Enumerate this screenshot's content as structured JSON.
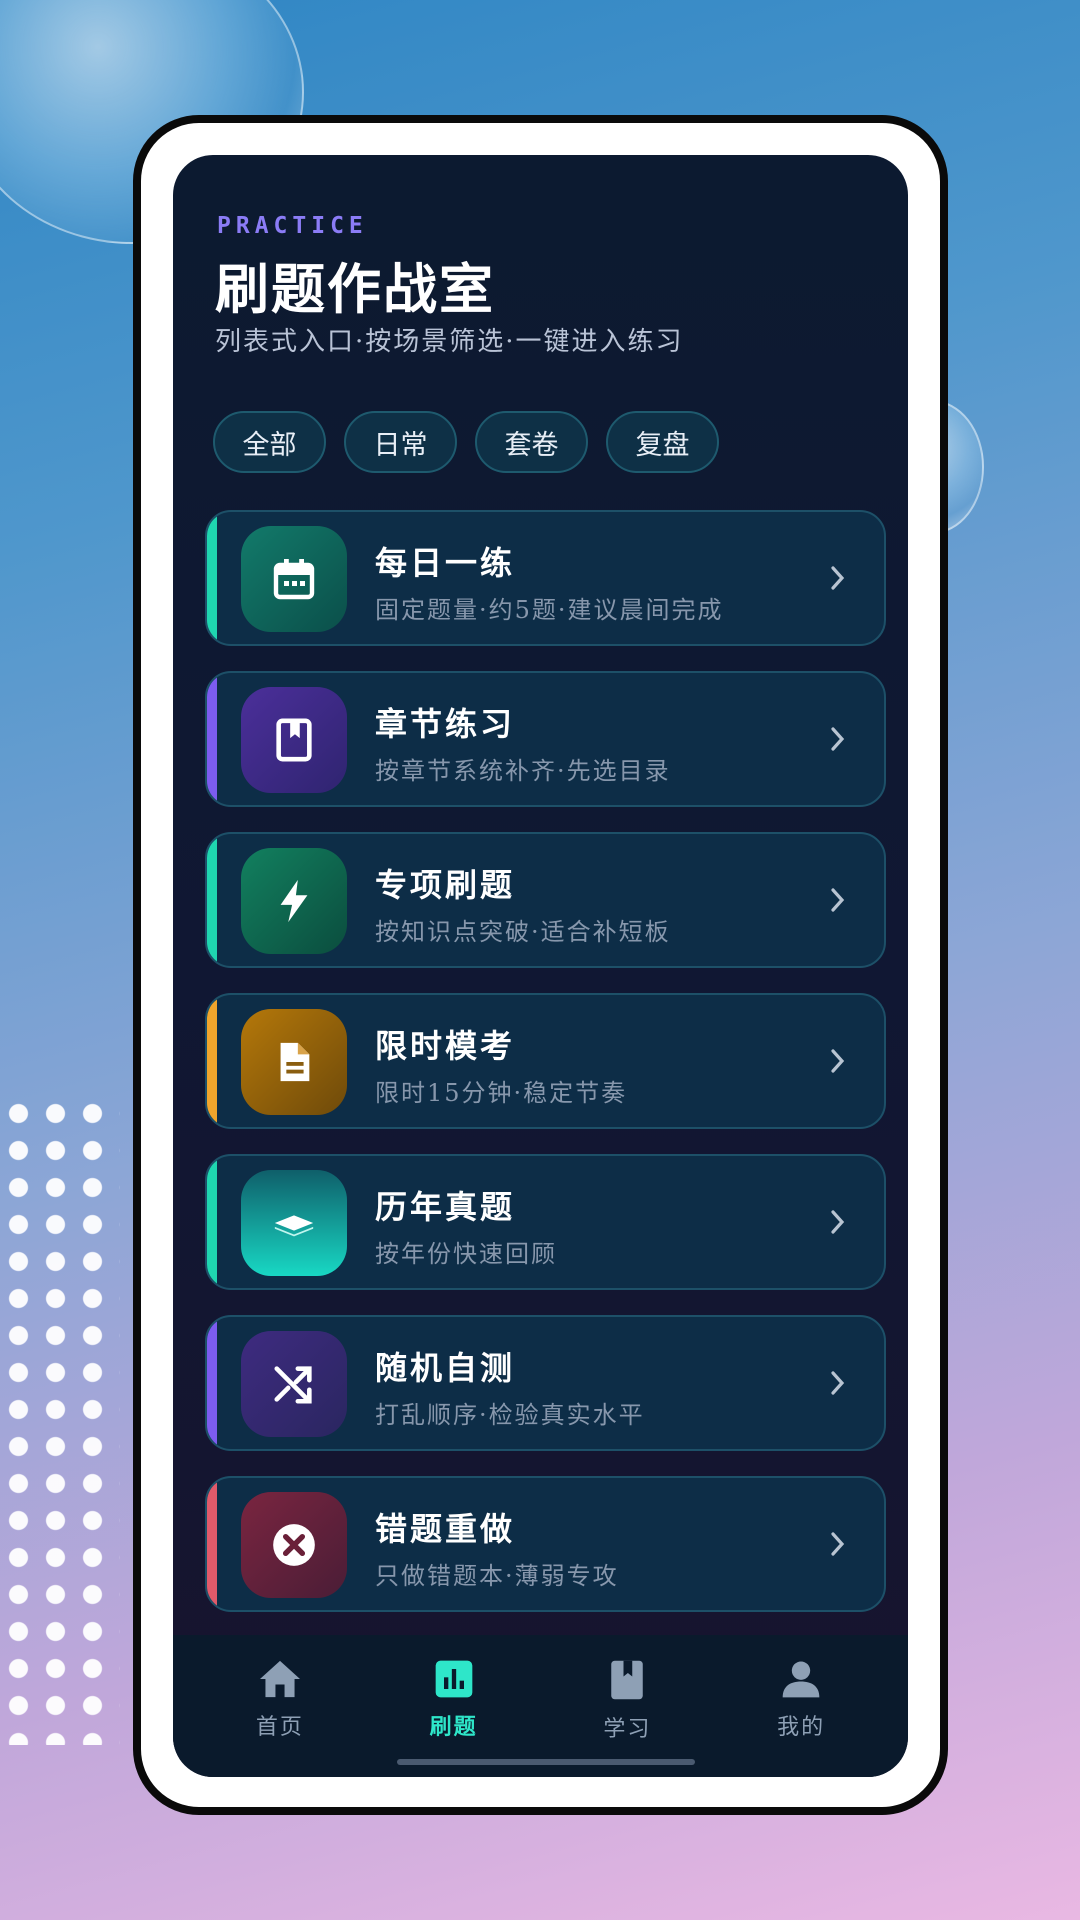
{
  "header": {
    "eyebrow": "PRACTICE",
    "title": "刷题作战室",
    "subtitle": "列表式入口·按场景筛选·一键进入练习"
  },
  "filters": [
    {
      "label": "全部"
    },
    {
      "label": "日常"
    },
    {
      "label": "套卷"
    },
    {
      "label": "复盘"
    }
  ],
  "items": [
    {
      "title": "每日一练",
      "desc": "固定题量·约5题·建议晨间完成",
      "icon": "calendar-icon",
      "accent": "#1fd6b0"
    },
    {
      "title": "章节练习",
      "desc": "按章节系统补齐·先选目录",
      "icon": "book-icon",
      "accent": "#7c5cf0"
    },
    {
      "title": "专项刷题",
      "desc": "按知识点突破·适合补短板",
      "icon": "lightning-icon",
      "accent": "#1fd6b0"
    },
    {
      "title": "限时模考",
      "desc": "限时15分钟·稳定节奏",
      "icon": "document-icon",
      "accent": "#f0a52c"
    },
    {
      "title": "历年真题",
      "desc": "按年份快速回顾",
      "icon": "layers-icon",
      "accent": "#1fd6b0"
    },
    {
      "title": "随机自测",
      "desc": "打乱顺序·检验真实水平",
      "icon": "shuffle-icon",
      "accent": "#7c5cf0"
    },
    {
      "title": "错题重做",
      "desc": "只做错题本·薄弱专攻",
      "icon": "close-circle-icon",
      "accent": "#e05a6a"
    }
  ],
  "tabs": [
    {
      "label": "首页",
      "icon": "home-icon",
      "active": false
    },
    {
      "label": "刷题",
      "icon": "chart-icon",
      "active": true
    },
    {
      "label": "学习",
      "icon": "book-icon",
      "active": false
    },
    {
      "label": "我的",
      "icon": "user-icon",
      "active": false
    }
  ]
}
